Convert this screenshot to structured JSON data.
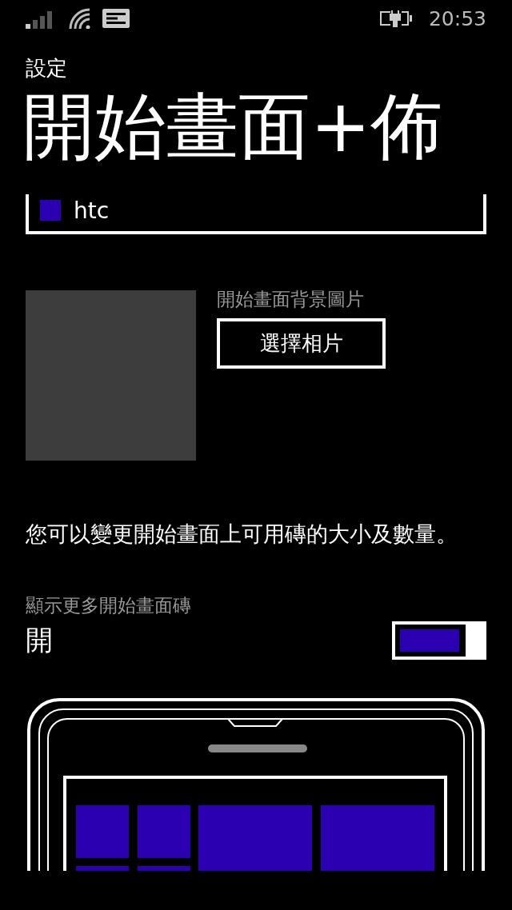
{
  "status_bar": {
    "time": "20:53"
  },
  "app_title": "設定",
  "page_title": "開始畫面+佈",
  "accent": {
    "name": "htc",
    "color": "#2a00b0"
  },
  "background": {
    "label": "開始畫面背景圖片",
    "button": "選擇相片"
  },
  "description": "您可以變更開始畫面上可用磚的大小及數量。",
  "more_tiles": {
    "label": "顯示更多開始畫面磚",
    "state_text": "開",
    "on": true
  }
}
